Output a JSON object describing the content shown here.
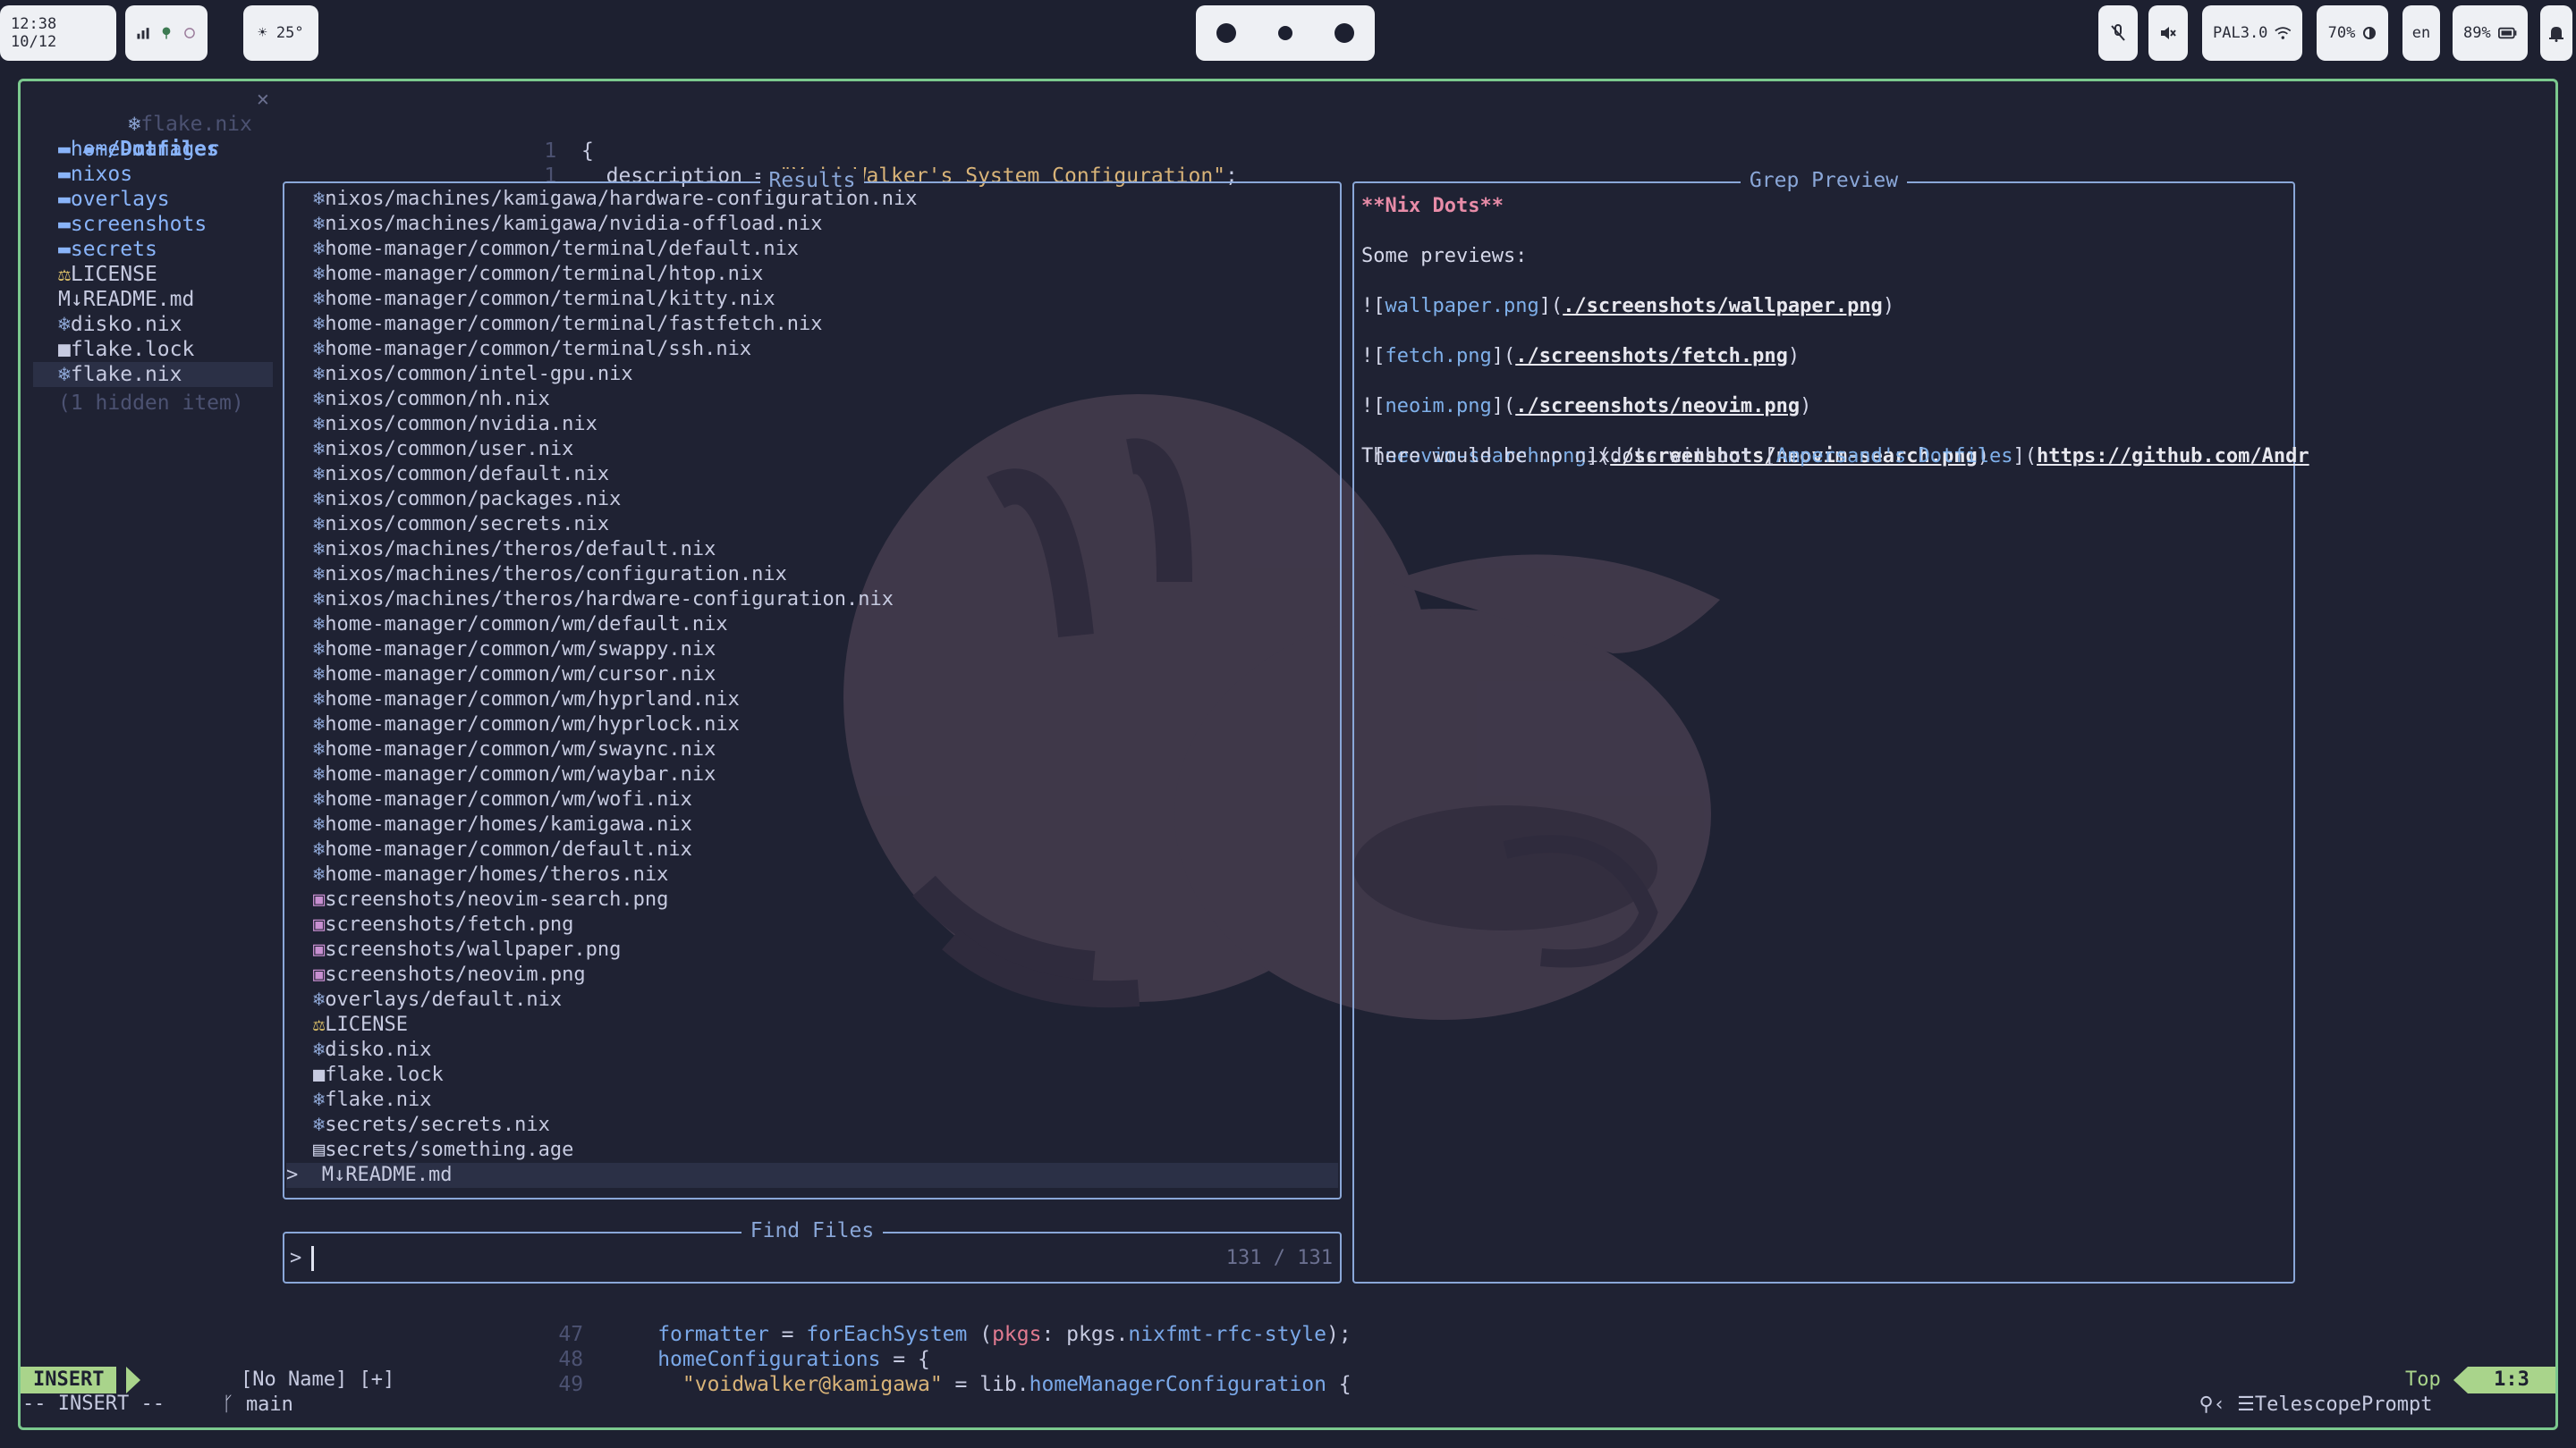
{
  "topbar": {
    "clock": "12:38 10/12",
    "weather": "☀ 25°",
    "network": "PAL3.0",
    "brightness": "70%",
    "lang": "en",
    "battery": "89%"
  },
  "tab": {
    "file": "flake.nix",
    "close": "✕"
  },
  "sidebar": {
    "root": "~/Dotfiles",
    "items": [
      {
        "label": "home-manager",
        "kind": "folder"
      },
      {
        "label": "nixos",
        "kind": "folder"
      },
      {
        "label": "overlays",
        "kind": "folder"
      },
      {
        "label": "screenshots",
        "kind": "folder"
      },
      {
        "label": "secrets",
        "kind": "folder"
      },
      {
        "label": "LICENSE",
        "kind": "license"
      },
      {
        "label": "README.md",
        "kind": "md"
      },
      {
        "label": "disko.nix",
        "kind": "nix"
      },
      {
        "label": "flake.lock",
        "kind": "lock"
      },
      {
        "label": "flake.nix",
        "kind": "nix"
      }
    ],
    "hidden": "(1 hidden item)"
  },
  "code_top": [
    {
      "num": "1",
      "text": "{"
    },
    {
      "num": "1",
      "text": "  description = \"Void Walker's System Configuration\";"
    }
  ],
  "results": {
    "title": "Results",
    "rows": [
      {
        "icon": "nix",
        "path": "nixos/machines/kamigawa/hardware-configuration.nix"
      },
      {
        "icon": "nix",
        "path": "nixos/machines/kamigawa/nvidia-offload.nix"
      },
      {
        "icon": "nix",
        "path": "home-manager/common/terminal/default.nix"
      },
      {
        "icon": "nix",
        "path": "home-manager/common/terminal/htop.nix"
      },
      {
        "icon": "nix",
        "path": "home-manager/common/terminal/kitty.nix"
      },
      {
        "icon": "nix",
        "path": "home-manager/common/terminal/fastfetch.nix"
      },
      {
        "icon": "nix",
        "path": "home-manager/common/terminal/ssh.nix"
      },
      {
        "icon": "nix",
        "path": "nixos/common/intel-gpu.nix"
      },
      {
        "icon": "nix",
        "path": "nixos/common/nh.nix"
      },
      {
        "icon": "nix",
        "path": "nixos/common/nvidia.nix"
      },
      {
        "icon": "nix",
        "path": "nixos/common/user.nix"
      },
      {
        "icon": "nix",
        "path": "nixos/common/default.nix"
      },
      {
        "icon": "nix",
        "path": "nixos/common/packages.nix"
      },
      {
        "icon": "nix",
        "path": "nixos/common/secrets.nix"
      },
      {
        "icon": "nix",
        "path": "nixos/machines/theros/default.nix"
      },
      {
        "icon": "nix",
        "path": "nixos/machines/theros/configuration.nix"
      },
      {
        "icon": "nix",
        "path": "nixos/machines/theros/hardware-configuration.nix"
      },
      {
        "icon": "nix",
        "path": "home-manager/common/wm/default.nix"
      },
      {
        "icon": "nix",
        "path": "home-manager/common/wm/swappy.nix"
      },
      {
        "icon": "nix",
        "path": "home-manager/common/wm/cursor.nix"
      },
      {
        "icon": "nix",
        "path": "home-manager/common/wm/hyprland.nix"
      },
      {
        "icon": "nix",
        "path": "home-manager/common/wm/hyprlock.nix"
      },
      {
        "icon": "nix",
        "path": "home-manager/common/wm/swaync.nix"
      },
      {
        "icon": "nix",
        "path": "home-manager/common/wm/waybar.nix"
      },
      {
        "icon": "nix",
        "path": "home-manager/common/wm/wofi.nix"
      },
      {
        "icon": "nix",
        "path": "home-manager/homes/kamigawa.nix"
      },
      {
        "icon": "nix",
        "path": "home-manager/common/default.nix"
      },
      {
        "icon": "nix",
        "path": "home-manager/homes/theros.nix"
      },
      {
        "icon": "img",
        "path": "screenshots/neovim-search.png"
      },
      {
        "icon": "img",
        "path": "screenshots/fetch.png"
      },
      {
        "icon": "img",
        "path": "screenshots/wallpaper.png"
      },
      {
        "icon": "img",
        "path": "screenshots/neovim.png"
      },
      {
        "icon": "nix",
        "path": "overlays/default.nix"
      },
      {
        "icon": "license",
        "path": "LICENSE"
      },
      {
        "icon": "nix",
        "path": "disko.nix"
      },
      {
        "icon": "lock",
        "path": "flake.lock"
      },
      {
        "icon": "nix",
        "path": "flake.nix"
      },
      {
        "icon": "nix",
        "path": "secrets/secrets.nix"
      },
      {
        "icon": "file",
        "path": "secrets/something.age"
      },
      {
        "icon": "md",
        "path": "README.md"
      }
    ],
    "caret": ">"
  },
  "find": {
    "title": "Find Files",
    "prompt": ">",
    "count": "131 / 131"
  },
  "preview": {
    "title": "Grep Preview",
    "heading": "**Nix Dots**",
    "intro": "Some previews:",
    "images": [
      {
        "alt": "wallpaper.png",
        "path": "./screenshots/wallpaper.png"
      },
      {
        "alt": "fetch.png",
        "path": "./screenshots/fetch.png"
      },
      {
        "alt": "neoim.png",
        "path": "./screenshots/neovim.png"
      },
      {
        "alt": "neovim-search.png",
        "path": "./screenshots/neovim-search.png"
      }
    ],
    "thanks_pre": "There would be no nixdots without [",
    "thanks_link_text": "Ampersand's Dotfiles",
    "thanks_url": "https://github.com/Andr"
  },
  "code_bottom": [
    {
      "num": "47",
      "text": "formatter = forEachSystem (pkgs: pkgs.nixfmt-rfc-style);"
    },
    {
      "num": "48",
      "text": "homeConfigurations = {"
    },
    {
      "num": "49",
      "text": "  \"voidwalker@kamigawa\" = lib.homeManagerConfiguration {"
    }
  ],
  "statusline": {
    "mode": "INSERT",
    "branch": "main",
    "buffer": "[No Name] [+]",
    "filetype": "TelescopePrompt",
    "position": "Top",
    "cursor": "1:3"
  },
  "cmdline": "-- INSERT --",
  "colors": {
    "background": "#1f2233",
    "border_green": "#7bc98e",
    "telescope_border": "#8aa7d8",
    "insert_mode": "#a9d48b"
  }
}
